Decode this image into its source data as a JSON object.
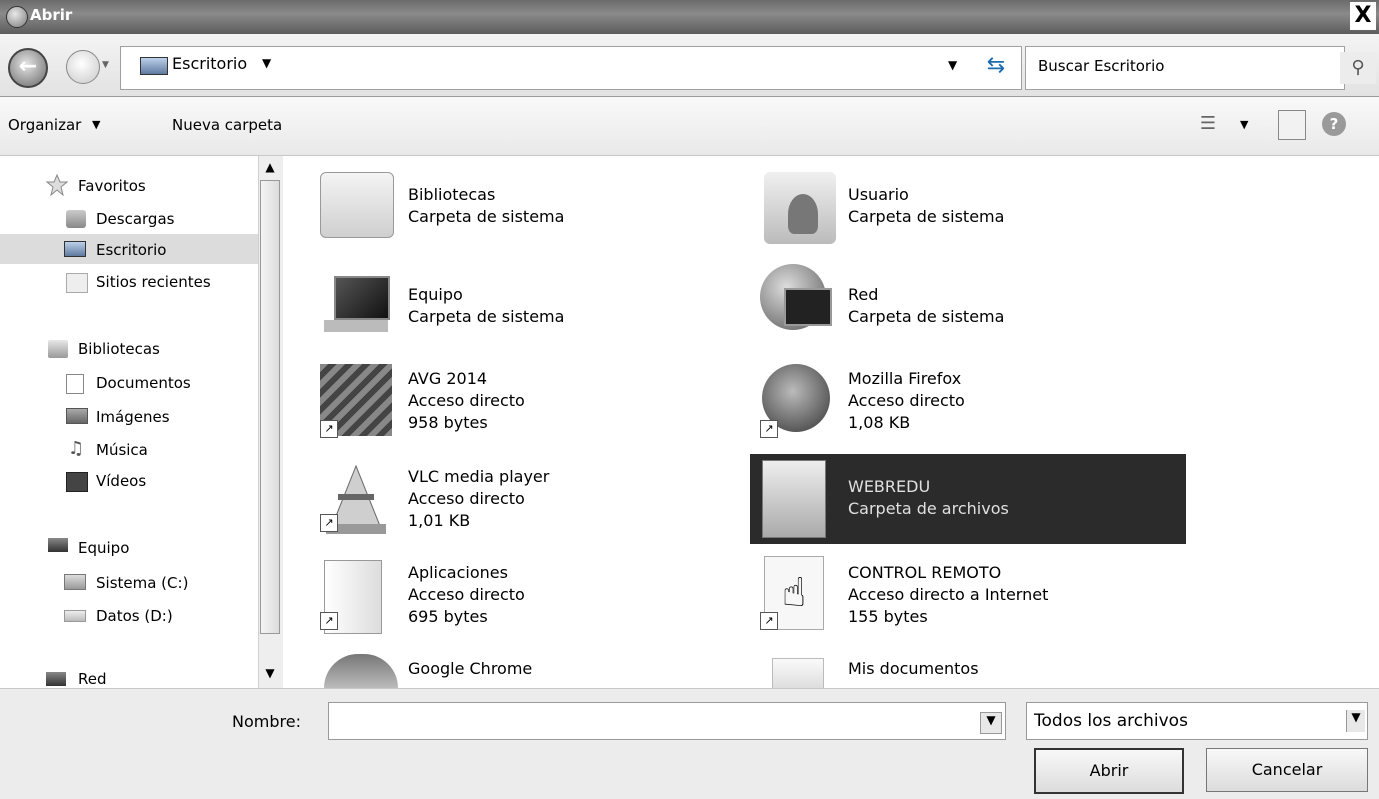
{
  "window": {
    "title": "Abrir",
    "close_glyph": "X"
  },
  "address": {
    "location": "Escritorio",
    "search_placeholder": "Buscar Escritorio"
  },
  "toolbar": {
    "organize": "Organizar",
    "new_folder": "Nueva carpeta"
  },
  "nav": {
    "favorites": {
      "label": "Favoritos",
      "items": [
        "Descargas",
        "Escritorio",
        "Sitios recientes"
      ],
      "selected": "Escritorio"
    },
    "libraries": {
      "label": "Bibliotecas",
      "items": [
        "Documentos",
        "Imágenes",
        "Música",
        "Vídeos"
      ]
    },
    "computer": {
      "label": "Equipo",
      "items": [
        "Sistema (C:)",
        "Datos (D:)"
      ]
    },
    "network": {
      "label": "Red"
    }
  },
  "items": [
    {
      "name": "Bibliotecas",
      "type": "Carpeta de sistema",
      "size": "",
      "icon": "libraries-icon"
    },
    {
      "name": "Usuario",
      "type": "Carpeta de sistema",
      "size": "",
      "icon": "user-folder-icon"
    },
    {
      "name": "Equipo",
      "type": "Carpeta de sistema",
      "size": "",
      "icon": "computer-icon"
    },
    {
      "name": "Red",
      "type": "Carpeta de sistema",
      "size": "",
      "icon": "network-icon"
    },
    {
      "name": "AVG 2014",
      "type": "Acceso directo",
      "size": "958 bytes",
      "icon": "avg-icon"
    },
    {
      "name": "Mozilla Firefox",
      "type": "Acceso directo",
      "size": "1,08 KB",
      "icon": "firefox-icon"
    },
    {
      "name": "VLC media player",
      "type": "Acceso directo",
      "size": "1,01 KB",
      "icon": "vlc-icon"
    },
    {
      "name": "WEBREDU",
      "type": "Carpeta de archivos",
      "size": "",
      "icon": "folder-icon",
      "selected": true
    },
    {
      "name": "Aplicaciones",
      "type": "Acceso directo",
      "size": "695 bytes",
      "icon": "applications-icon"
    },
    {
      "name": "CONTROL REMOTO",
      "type": "Acceso directo a Internet",
      "size": "155 bytes",
      "icon": "internet-shortcut-icon"
    },
    {
      "name": "Google Chrome",
      "type": "",
      "size": "",
      "icon": "chrome-icon"
    },
    {
      "name": "Mis documentos",
      "type": "",
      "size": "",
      "icon": "documents-icon"
    }
  ],
  "bottom": {
    "name_label": "Nombre:",
    "name_value": "",
    "filter": "Todos los archivos",
    "open": "Abrir",
    "cancel": "Cancelar"
  }
}
